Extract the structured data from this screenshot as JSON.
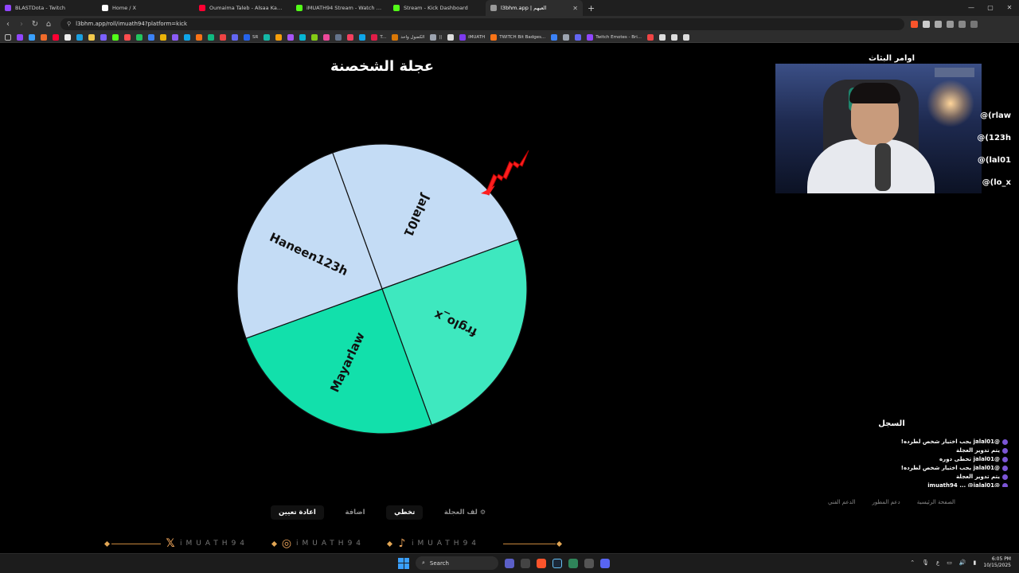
{
  "browser": {
    "tabs": [
      {
        "title": "BLASTDota - Twitch",
        "color": "#9146ff",
        "active": false
      },
      {
        "title": "Home / X",
        "color": "#ffffff",
        "active": false
      },
      {
        "title": "Oumaima Taleb - Alsaa Kam | Offi",
        "color": "#ff0033",
        "active": false
      },
      {
        "title": "iMUATH94 Stream - Watch Live o",
        "color": "#53fc18",
        "active": false
      },
      {
        "title": "Stream - Kick Dashboard",
        "color": "#53fc18",
        "active": false
      },
      {
        "title": "l3bhm.app | العبهم",
        "color": "#999999",
        "active": true
      }
    ],
    "new_tab": "+",
    "window_controls": [
      "—",
      "▢",
      "✕"
    ],
    "url": "l3bhm.app/roll/imuath94?platform=kick",
    "bookmarks": [
      {
        "label": "",
        "color": "#9146ff"
      },
      {
        "label": "",
        "color": "#3aa0ff"
      },
      {
        "label": "",
        "color": "#f06b2a"
      },
      {
        "label": "",
        "color": "#ff0033"
      },
      {
        "label": "",
        "color": "#eeeeee"
      },
      {
        "label": "",
        "color": "#1ba1e2"
      },
      {
        "label": "",
        "color": "#f2c94c"
      },
      {
        "label": "",
        "color": "#7b61ff"
      },
      {
        "label": "",
        "color": "#53fc18"
      },
      {
        "label": "",
        "color": "#ff4d4f"
      },
      {
        "label": "",
        "color": "#22c55e"
      },
      {
        "label": "",
        "color": "#3b82f6"
      },
      {
        "label": "",
        "color": "#eab308"
      },
      {
        "label": "",
        "color": "#8b5cf6"
      },
      {
        "label": "",
        "color": "#0ea5e9"
      },
      {
        "label": "",
        "color": "#f97316"
      },
      {
        "label": "",
        "color": "#10b981"
      },
      {
        "label": "",
        "color": "#ef4444"
      },
      {
        "label": "",
        "color": "#6366f1"
      },
      {
        "label": "SR",
        "color": "#2563eb"
      },
      {
        "label": "",
        "color": "#14b8a6"
      },
      {
        "label": "",
        "color": "#f59e0b"
      },
      {
        "label": "",
        "color": "#a855f7"
      },
      {
        "label": "",
        "color": "#06b6d4"
      },
      {
        "label": "",
        "color": "#84cc16"
      },
      {
        "label": "",
        "color": "#ec4899"
      },
      {
        "label": "",
        "color": "#64748b"
      },
      {
        "label": "",
        "color": "#f43f5e"
      },
      {
        "label": "",
        "color": "#0ea5e9"
      },
      {
        "label": "T...",
        "color": "#e11d48"
      },
      {
        "label": "الكضول واحد",
        "color": "#d97706"
      },
      {
        "label": "||",
        "color": "#9ca3af"
      },
      {
        "label": "",
        "color": "#dddddd"
      },
      {
        "label": "iMUATH",
        "color": "#7c3aed"
      },
      {
        "label": "TWITCH Bit Badges...",
        "color": "#f97316"
      },
      {
        "label": "",
        "color": "#3b82f6"
      },
      {
        "label": "",
        "color": "#9ca3af"
      },
      {
        "label": "",
        "color": "#6366f1"
      },
      {
        "label": "Twitch Emotes - Bri...",
        "color": "#9146ff"
      },
      {
        "label": "",
        "color": "#ef4444"
      },
      {
        "label": "",
        "color": "#dddddd"
      },
      {
        "label": "",
        "color": "#dddddd"
      },
      {
        "label": "",
        "color": "#dddddd"
      }
    ]
  },
  "page": {
    "title": "عجلة الشخصنة",
    "commands_title": "اوامر البثاث",
    "commands": [
      "@(rlaw",
      "@(123h",
      "@(lal01",
      "@(lo_x"
    ],
    "wheel": {
      "segments": [
        {
          "name": "Jalal01",
          "color": "#c4dcf5"
        },
        {
          "name": "frglo_x",
          "color": "#3ee8bf"
        },
        {
          "name": "Mayarlaw",
          "color": "#12e0ab"
        },
        {
          "name": "Haneen123h",
          "color": "#c4dcf5"
        }
      ]
    },
    "log_title": "السجل",
    "log": [
      "@jalal01 يجب اختيار شخص لطرده!",
      "يتم تدوير العجلة",
      "@jalal01 تخطى دوره",
      "@jalal01 يجب اختيار شخص لطرده!",
      "يتم تدوير العجلة",
      "@imuath94 ... @jalal01"
    ],
    "footer_links": [
      "الصفحة الرئيسية",
      "دعم المطور",
      "الدعم الفني"
    ],
    "controls": {
      "spin": "لف العجلة",
      "skip": "تخطي",
      "add": "اضافة",
      "reset": "اعادة تعيين"
    },
    "brand_text": "iMUATH94"
  },
  "taskbar": {
    "search": "Search",
    "time": "6:05 PM",
    "date": "10/15/2025",
    "lang": "ع"
  }
}
